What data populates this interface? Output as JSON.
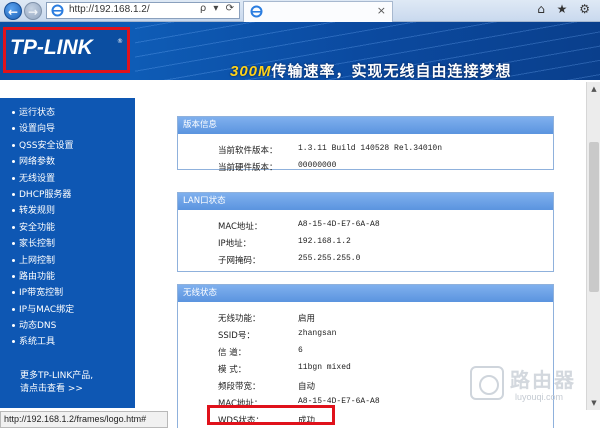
{
  "browser": {
    "url": "http://192.168.1.2/",
    "tools": "ρ ▾ ⟳",
    "tab_close": "×",
    "right_icons": "⌂ ★ ⚙"
  },
  "banner": {
    "logo": "TP-LINK",
    "logo_reg": "®",
    "slogan_hl": "300M",
    "slogan": "传输速率，实现无线自由连接梦想"
  },
  "sidebar": {
    "items": [
      {
        "label": "运行状态"
      },
      {
        "label": "设置向导"
      },
      {
        "label": "QSS安全设置"
      },
      {
        "label": "网络参数"
      },
      {
        "label": "无线设置"
      },
      {
        "label": "DHCP服务器"
      },
      {
        "label": "转发规则"
      },
      {
        "label": "安全功能"
      },
      {
        "label": "家长控制"
      },
      {
        "label": "上网控制"
      },
      {
        "label": "路由功能"
      },
      {
        "label": "IP带宽控制"
      },
      {
        "label": "IP与MAC绑定"
      },
      {
        "label": "动态DNS"
      },
      {
        "label": "系统工具"
      }
    ],
    "more_line1": "更多TP-LINK产品,",
    "more_line2": "请点击查看 >>"
  },
  "panels": {
    "version": {
      "title": "版本信息",
      "rows": [
        {
          "label": "当前软件版本：",
          "value": "1.3.11 Build 140528 Rel.34010n"
        },
        {
          "label": "当前硬件版本：",
          "value": "00000000"
        }
      ]
    },
    "lan": {
      "title": "LAN口状态",
      "rows": [
        {
          "label": "MAC地址：",
          "value": "A8-15-4D-E7-6A-A8"
        },
        {
          "label": "IP地址：",
          "value": "192.168.1.2"
        },
        {
          "label": "子网掩码：",
          "value": "255.255.255.0"
        }
      ]
    },
    "wireless": {
      "title": "无线状态",
      "rows": [
        {
          "label": "无线功能：",
          "value": "启用"
        },
        {
          "label": "SSID号：",
          "value": "zhangsan"
        },
        {
          "label": "信 道：",
          "value": "6"
        },
        {
          "label": "模 式：",
          "value": "11bgn mixed"
        },
        {
          "label": "频段带宽：",
          "value": "自动"
        },
        {
          "label": "MAC地址：",
          "value": "A8-15-4D-E7-6A-A8"
        },
        {
          "label": "WDS状态：",
          "value": "成功"
        }
      ]
    }
  },
  "statusbar": "http://192.168.1.2/frames/logo.htm#",
  "watermark": {
    "title": "路由器",
    "site": "luyouqi.com"
  },
  "colors": {
    "highlight_red": "#e0121b",
    "nav_blue": "#0e57b3",
    "panel_header": "#6b9fe5"
  }
}
